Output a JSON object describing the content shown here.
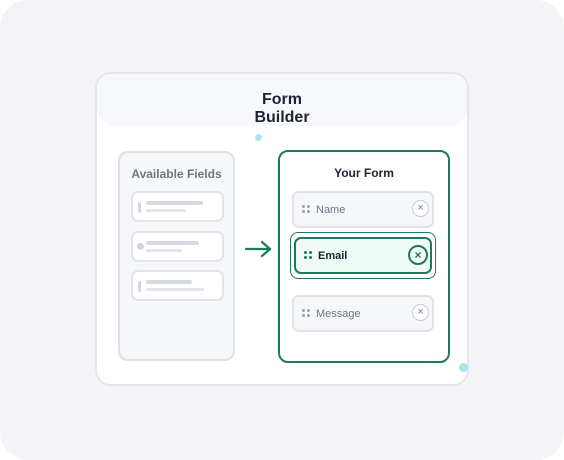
{
  "window": {
    "title": "Form\nBuilder"
  },
  "available": {
    "heading": "Available Fields",
    "items": [
      {
        "icon": "text-field-icon"
      },
      {
        "icon": "radio-field-icon"
      },
      {
        "icon": "textarea-field-icon"
      }
    ]
  },
  "arrow_icon": "arrow-right-icon",
  "form": {
    "heading": "Your Form",
    "fields": [
      {
        "label": "Name",
        "remove_icon": "close-icon",
        "selected": false
      },
      {
        "label": "Email",
        "remove_icon": "close-icon",
        "selected": true
      },
      {
        "label": "Message",
        "remove_icon": "close-icon",
        "selected": false
      }
    ],
    "remove_glyph": "×"
  },
  "colors": {
    "accent": "#1e7a5c",
    "accent_bg": "#effaf6",
    "background": "#f4f4f8",
    "decor_dot": "#a8e6ee"
  }
}
